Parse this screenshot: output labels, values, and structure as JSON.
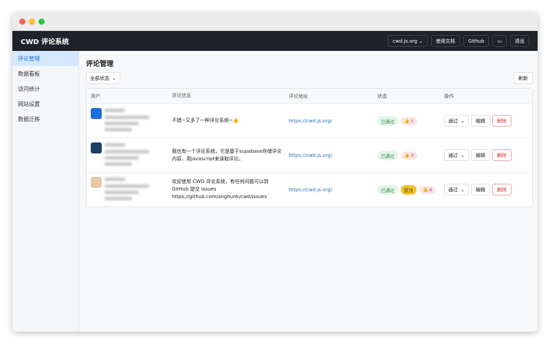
{
  "header": {
    "title": "CWD 评论系统",
    "site_select": "cwd.js.org",
    "docs": "使用文档",
    "github": "Github",
    "logout": "退出"
  },
  "sidebar": {
    "items": [
      {
        "label": "评论管理",
        "active": true
      },
      {
        "label": "数据看板"
      },
      {
        "label": "访问统计"
      },
      {
        "label": "网站设置"
      },
      {
        "label": "数据迁移"
      }
    ]
  },
  "main": {
    "title": "评论管理",
    "filter": "全部状态",
    "refresh": "刷新",
    "columns": [
      "用户",
      "评论信息",
      "评论地址",
      "状态",
      "操作"
    ],
    "rows": [
      {
        "content": "不错~又多了一种评论系统~👍",
        "url": "https://cwd.js.org/",
        "status": "已通过",
        "pinned": null,
        "likes": "1",
        "action": "通过",
        "edit": "编辑",
        "delete": "删除",
        "avatar_color": "#1a6fd8"
      },
      {
        "content": "我也有一个评论系统，它是基于supabase存储评论内容，用javascript来读取评论。",
        "url": "https://cwd.js.org/",
        "status": "已通过",
        "pinned": null,
        "likes": "3",
        "action": "通过",
        "edit": "编辑",
        "delete": "删除",
        "avatar_color": "#1d3f66"
      },
      {
        "content": "欢迎使用 CWD 评论系统，有任何问题可以到 GitHub 提交 Issues https://github.com/anghunk/cwd/issues",
        "url": "https://cwd.js.org/",
        "status": "已通过",
        "pinned": "置顶",
        "likes": "6",
        "action": "通过",
        "edit": "编辑",
        "delete": "删除",
        "avatar_color": "#e8c9a8"
      }
    ]
  },
  "colors": {
    "header_bg": "#1f2329",
    "accent": "#1a6fd8",
    "danger": "#d33"
  }
}
